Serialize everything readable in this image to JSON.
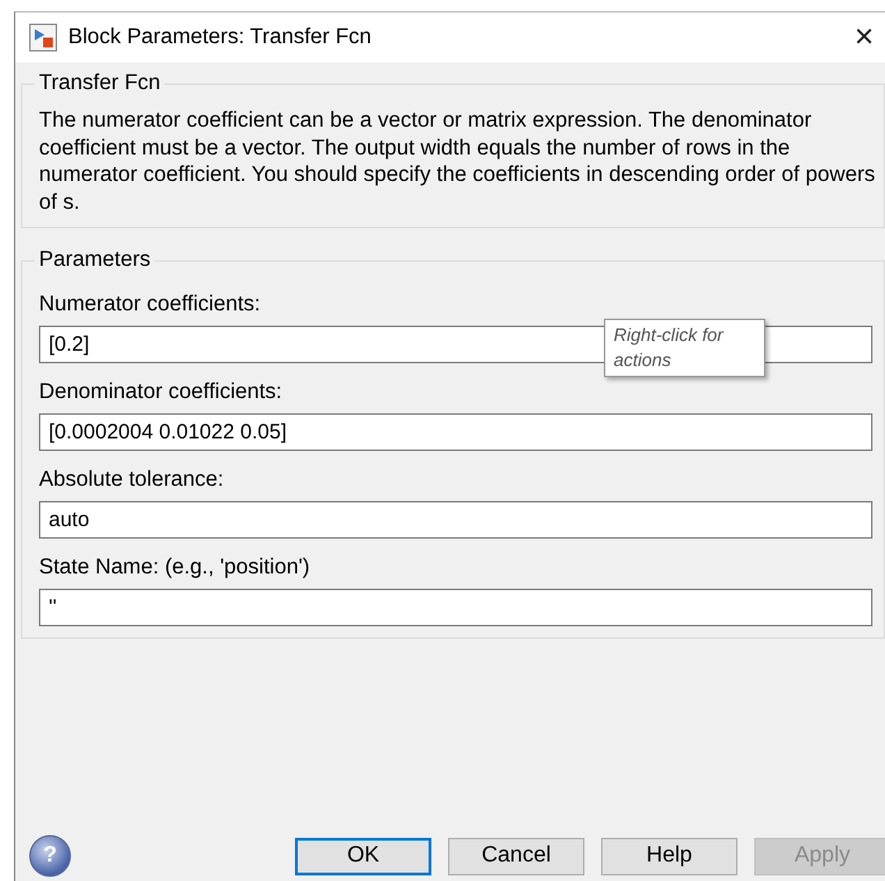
{
  "window": {
    "title": "Block Parameters: Transfer Fcn",
    "close": "×"
  },
  "description_group": {
    "title": "Transfer Fcn",
    "text": "The numerator coefficient can be a vector or matrix expression. The denominator coefficient must be a vector. The output width equals the number of rows in the numerator coefficient. You should specify the coefficients in descending order of powers of s."
  },
  "parameters_group": {
    "title": "Parameters",
    "fields": [
      {
        "label": "Numerator coefficients:",
        "value": "[0.2]",
        "tooltip": "Right-click for actions"
      },
      {
        "label": "Denominator coefficients:",
        "value": "[0.0002004 0.01022 0.05]"
      },
      {
        "label": "Absolute tolerance:",
        "value": "auto"
      },
      {
        "label": "State Name: (e.g., 'position')",
        "value": "''"
      }
    ]
  },
  "help_icon": {
    "glyph": "?"
  },
  "buttons": [
    {
      "label": "OK",
      "default": true,
      "disabled": false
    },
    {
      "label": "Cancel",
      "default": false,
      "disabled": false
    },
    {
      "label": "Help",
      "default": false,
      "disabled": false
    },
    {
      "label": "Apply",
      "default": false,
      "disabled": true
    }
  ]
}
